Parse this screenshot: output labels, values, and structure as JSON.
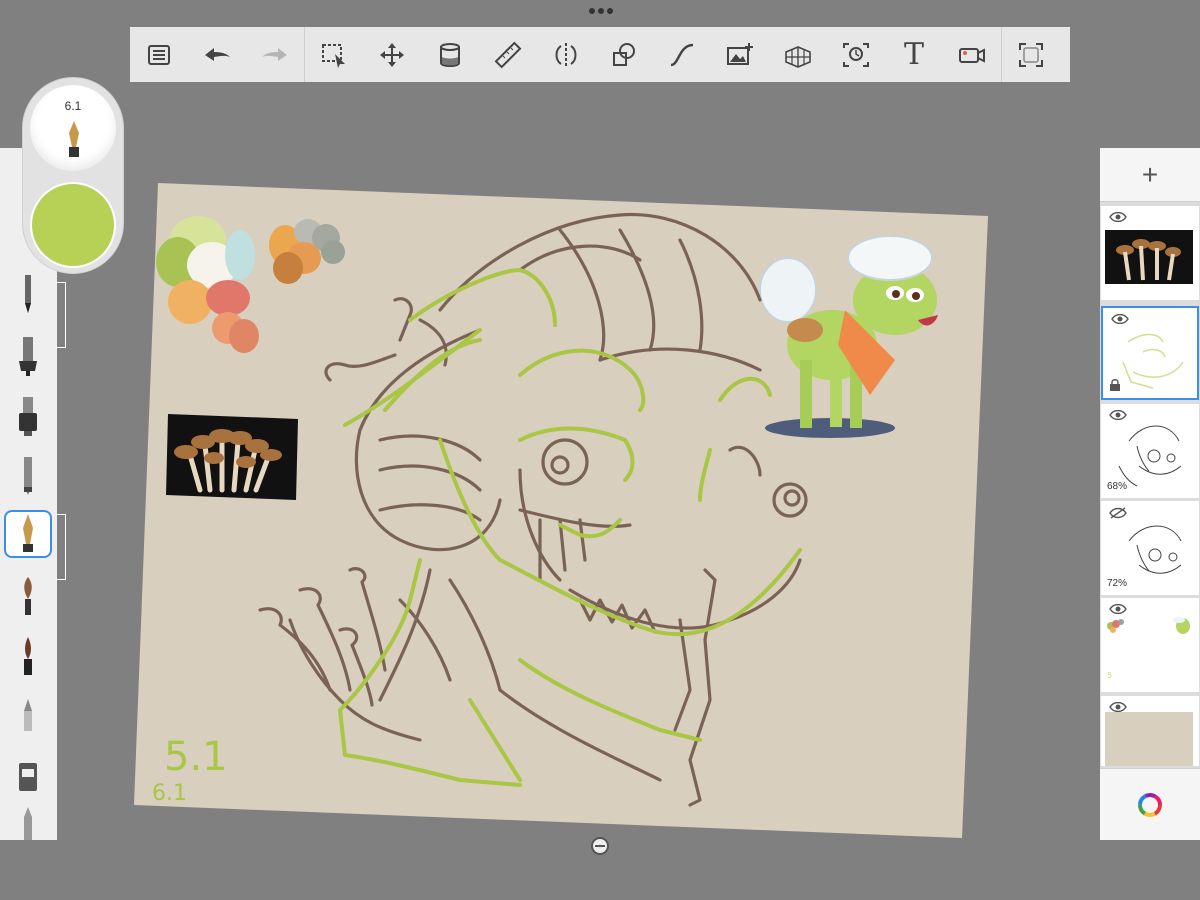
{
  "app": {
    "toolbar": {
      "tools": [
        {
          "name": "list-icon",
          "label": "Menu"
        },
        {
          "name": "undo-icon",
          "label": "Undo"
        },
        {
          "name": "redo-icon",
          "label": "Redo"
        },
        {
          "name": "selection-icon",
          "label": "Select"
        },
        {
          "name": "transform-icon",
          "label": "Transform"
        },
        {
          "name": "fill-icon",
          "label": "Fill"
        },
        {
          "name": "ruler-icon",
          "label": "Ruler"
        },
        {
          "name": "symmetry-icon",
          "label": "Symmetry"
        },
        {
          "name": "shape-icon",
          "label": "Shape"
        },
        {
          "name": "curve-icon",
          "label": "Curve"
        },
        {
          "name": "add-image-icon",
          "label": "Import image"
        },
        {
          "name": "perspective-icon",
          "label": "Perspective"
        },
        {
          "name": "time-lapse-icon",
          "label": "Time-lapse"
        },
        {
          "name": "text-icon",
          "label": "T"
        },
        {
          "name": "record-icon",
          "label": "Record"
        },
        {
          "name": "fullscreen-icon",
          "label": "Fullscreen"
        }
      ]
    },
    "brush_puck": {
      "size": "6.1",
      "color": "#b7d157"
    },
    "canvas": {
      "background": "#d8cfbe",
      "annotation_1": "5.1",
      "annotation_2": "6.1"
    },
    "layers": {
      "add_label": "+",
      "items": [
        {
          "name": "layer-photo",
          "visible": true
        },
        {
          "name": "layer-green-sketch",
          "visible": true,
          "selected": true,
          "locked": true
        },
        {
          "name": "layer-lineart",
          "visible": true,
          "opacity": "68%"
        },
        {
          "name": "layer-lineart-2",
          "visible": false,
          "opacity": "72%"
        },
        {
          "name": "layer-palette",
          "visible": true
        },
        {
          "name": "layer-background",
          "visible": true
        }
      ]
    }
  }
}
